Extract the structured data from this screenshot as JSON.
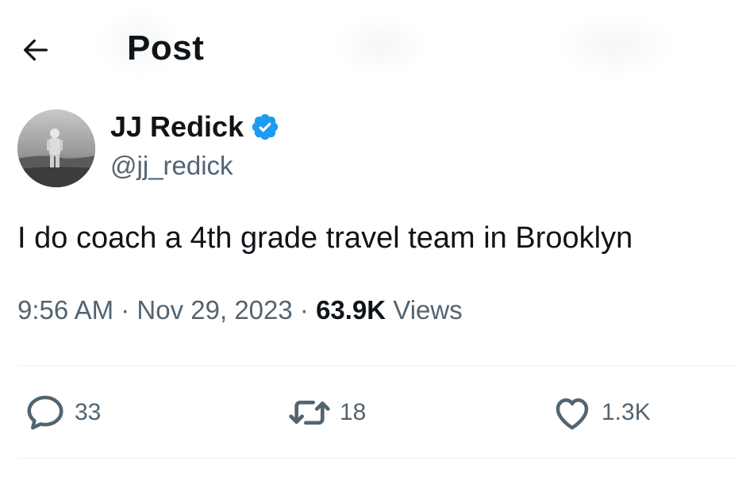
{
  "header": {
    "title": "Post",
    "back_icon": "arrow-left-icon"
  },
  "author": {
    "display_name": "JJ Redick",
    "handle": "@jj_redick",
    "verified": true,
    "verified_color": "#1d9bf0",
    "verified_icon": "verified-badge-icon"
  },
  "tweet": {
    "text": "I do coach a 4th grade travel team in Brooklyn"
  },
  "meta": {
    "time": "9:56 AM",
    "separator": "·",
    "date": "Nov 29, 2023",
    "views_count": "63.9K",
    "views_label": "Views"
  },
  "actions": {
    "replies": {
      "count": "33",
      "icon": "reply-icon"
    },
    "reposts": {
      "count": "18",
      "icon": "repost-icon"
    },
    "likes": {
      "count": "1.3K",
      "icon": "heart-icon"
    }
  },
  "colors": {
    "text": "#0f1419",
    "secondary": "#536471",
    "divider": "#eff3f4"
  }
}
